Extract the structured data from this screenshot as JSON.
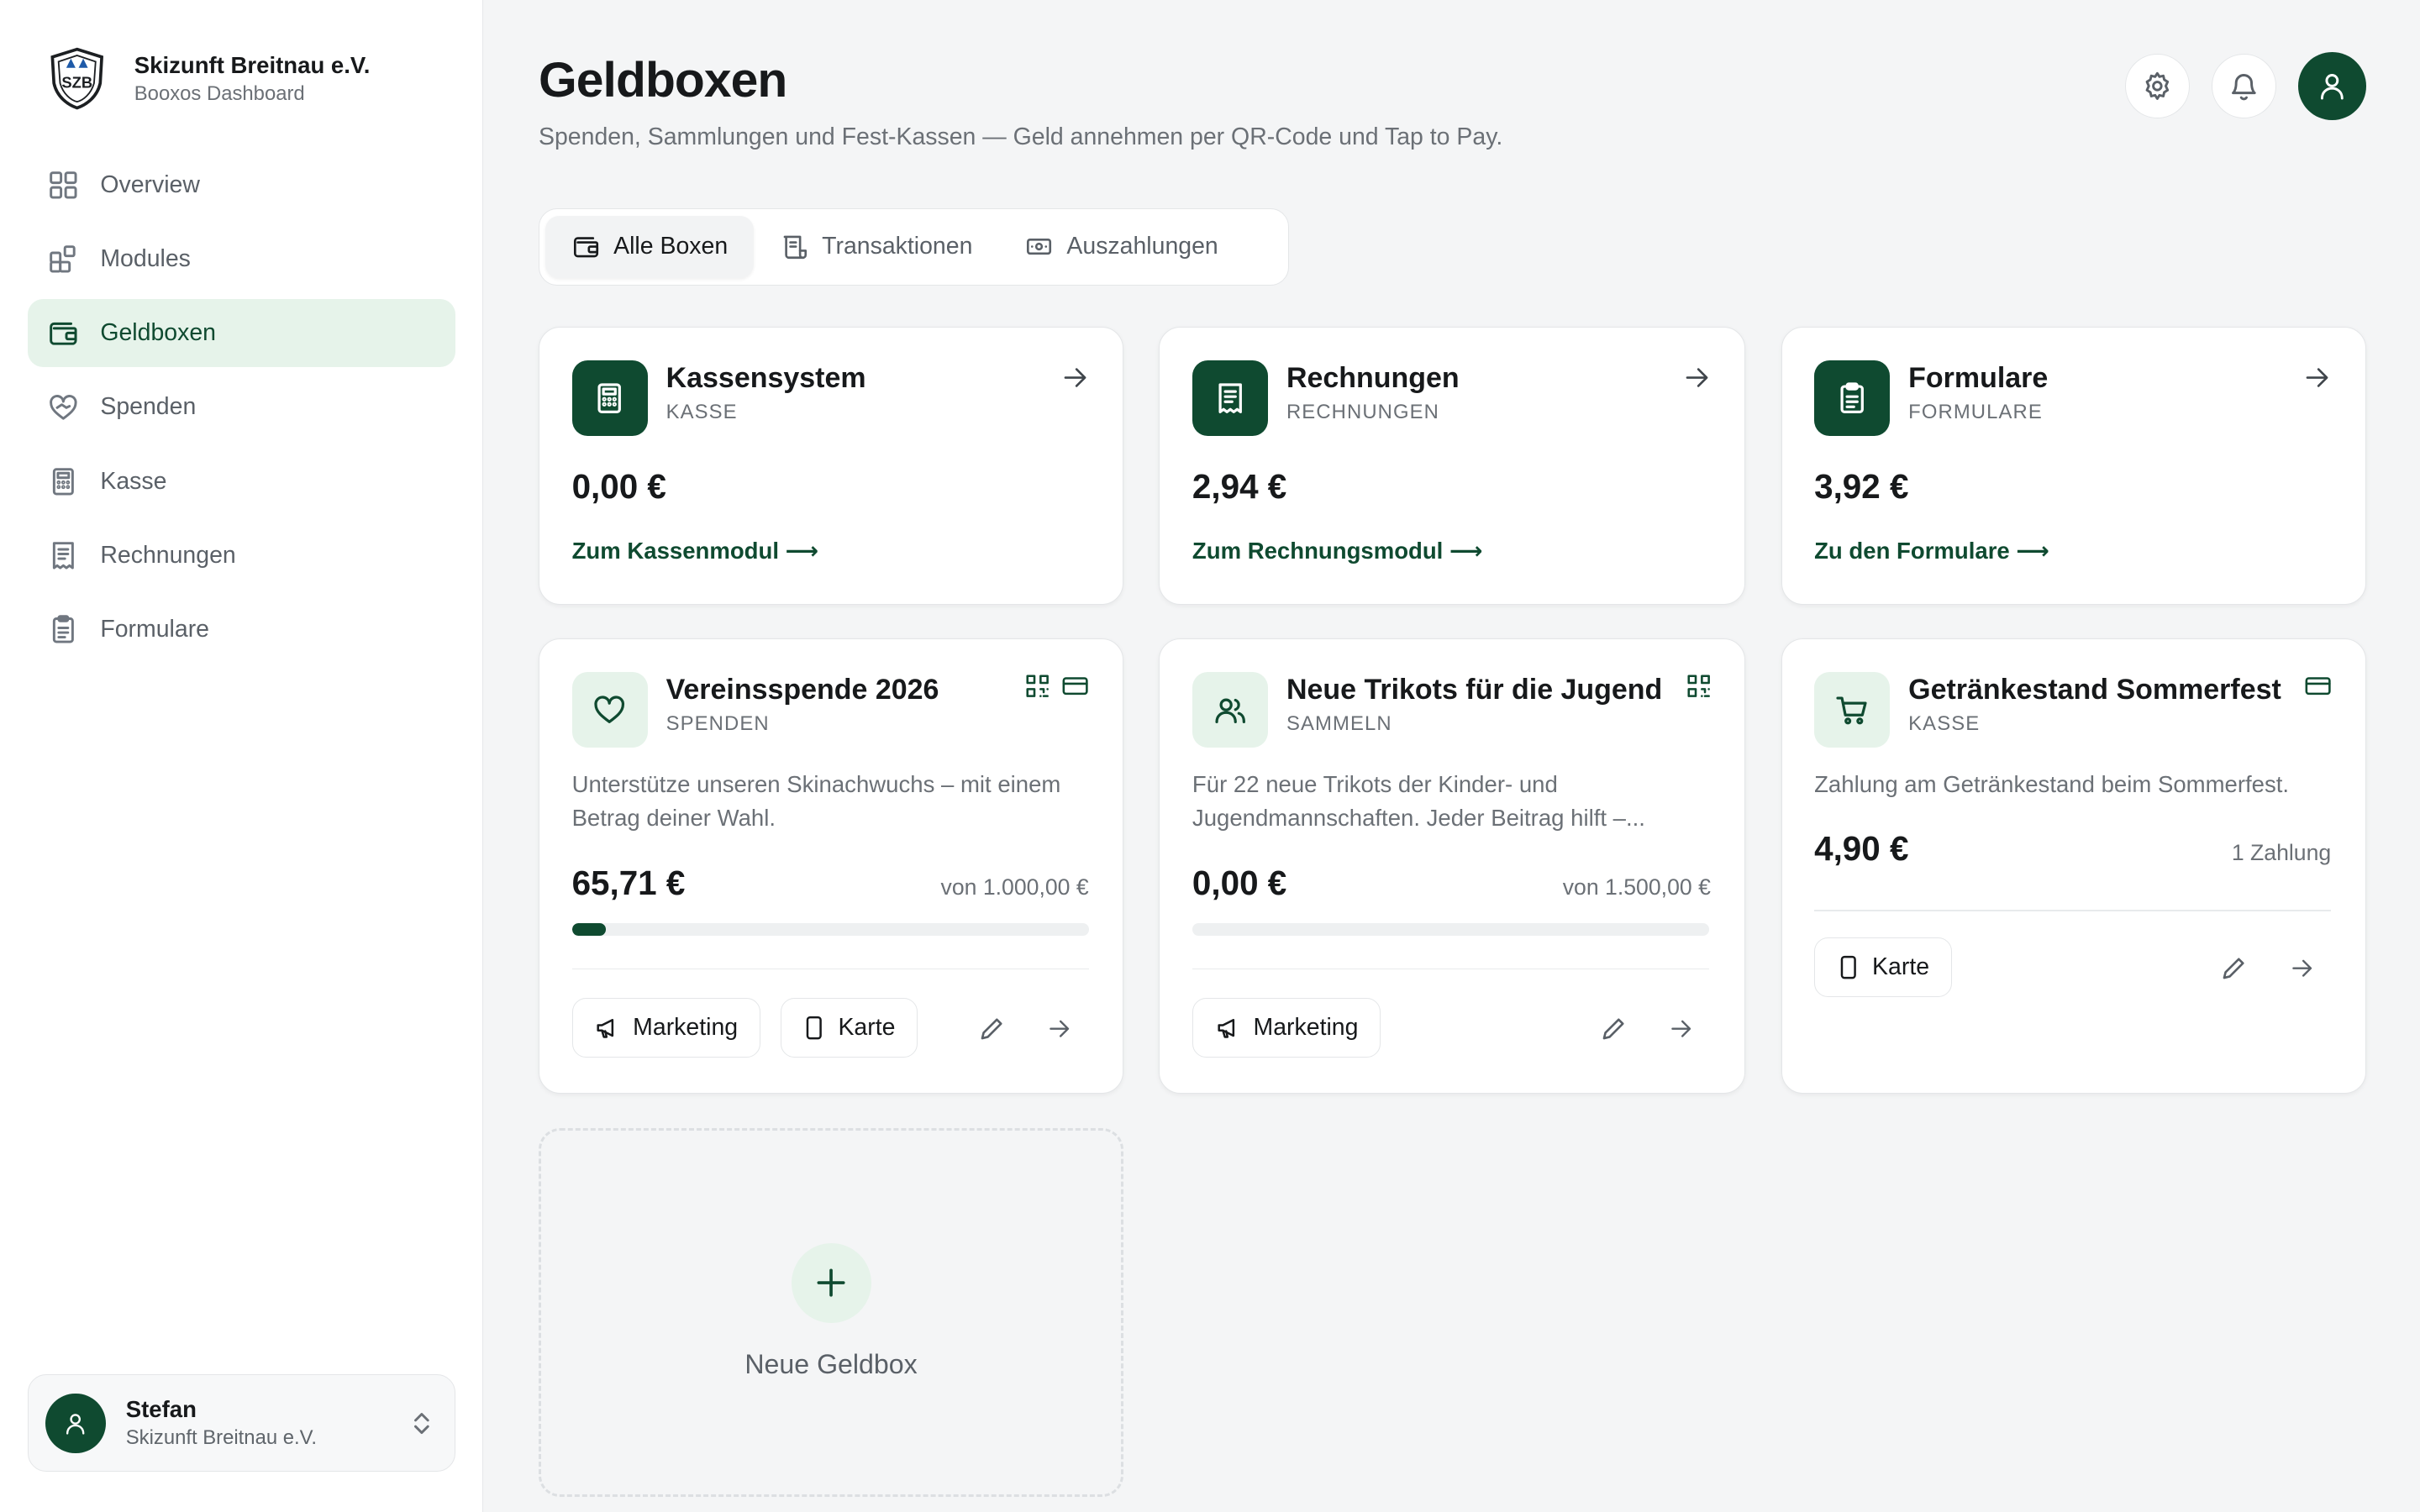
{
  "brand": {
    "name": "Skizunft Breitnau e.V.",
    "subtitle": "Booxos Dashboard",
    "logo_text": "SZB"
  },
  "nav": [
    {
      "label": "Overview",
      "icon": "grid-icon"
    },
    {
      "label": "Modules",
      "icon": "modules-icon"
    },
    {
      "label": "Geldboxen",
      "icon": "wallet-icon",
      "active": true
    },
    {
      "label": "Spenden",
      "icon": "heart-hand-icon"
    },
    {
      "label": "Kasse",
      "icon": "calculator-icon"
    },
    {
      "label": "Rechnungen",
      "icon": "receipt-icon"
    },
    {
      "label": "Formulare",
      "icon": "clipboard-icon"
    }
  ],
  "user": {
    "name": "Stefan",
    "org": "Skizunft Breitnau e.V."
  },
  "header": {
    "title": "Geldboxen",
    "subtitle": "Spenden, Sammlungen und Fest-Kassen — Geld annehmen per QR-Code und Tap to Pay."
  },
  "tabs": [
    {
      "label": "Alle Boxen",
      "icon": "wallet-icon",
      "active": true
    },
    {
      "label": "Transaktionen",
      "icon": "receipt-list-icon"
    },
    {
      "label": "Auszahlungen",
      "icon": "banknote-icon"
    }
  ],
  "module_cards": [
    {
      "title": "Kassensystem",
      "category": "KASSE",
      "amount": "0,00 €",
      "link": "Zum Kassenmodul ⟶",
      "icon": "calculator-icon"
    },
    {
      "title": "Rechnungen",
      "category": "RECHNUNGEN",
      "amount": "2,94 €",
      "link": "Zum Rechnungsmodul ⟶",
      "icon": "receipt-icon"
    },
    {
      "title": "Formulare",
      "category": "FORMULARE",
      "amount": "3,92 €",
      "link": "Zu den Formulare ⟶",
      "icon": "clipboard-icon"
    }
  ],
  "box_cards": [
    {
      "title": "Vereinsspende 2026",
      "category": "SPENDEN",
      "description": "Unterstütze unseren Skinachwuchs – mit einem Betrag deiner Wahl.",
      "amount": "65,71 €",
      "goal": "von 1.000,00 €",
      "progress": 0.0657,
      "chips": [
        "Marketing",
        "Karte"
      ],
      "icon": "heart-icon",
      "top_icons": [
        "qr-code-icon",
        "card-icon"
      ]
    },
    {
      "title": "Neue Trikots für die Jugend",
      "category": "SAMMELN",
      "description": "Für 22 neue Trikots der Kinder- und Jugendmannschaften. Jeder Beitrag hilft –...",
      "amount": "0,00 €",
      "goal": "von 1.500,00 €",
      "progress": 0,
      "chips": [
        "Marketing"
      ],
      "icon": "users-icon",
      "top_icons": [
        "qr-code-icon"
      ]
    },
    {
      "title": "Getränkestand Sommerfest",
      "category": "KASSE",
      "description": "Zahlung am Getränkestand beim Sommerfest.",
      "amount": "4,90 €",
      "count": "1 Zahlung",
      "chips": [
        "Karte"
      ],
      "icon": "cart-icon",
      "top_icons": [
        "card-icon"
      ]
    }
  ],
  "new_box": {
    "label": "Neue Geldbox"
  },
  "colors": {
    "brand": "#0f4a30",
    "brand_light": "#e6f3ea",
    "background": "#f4f5f6"
  }
}
